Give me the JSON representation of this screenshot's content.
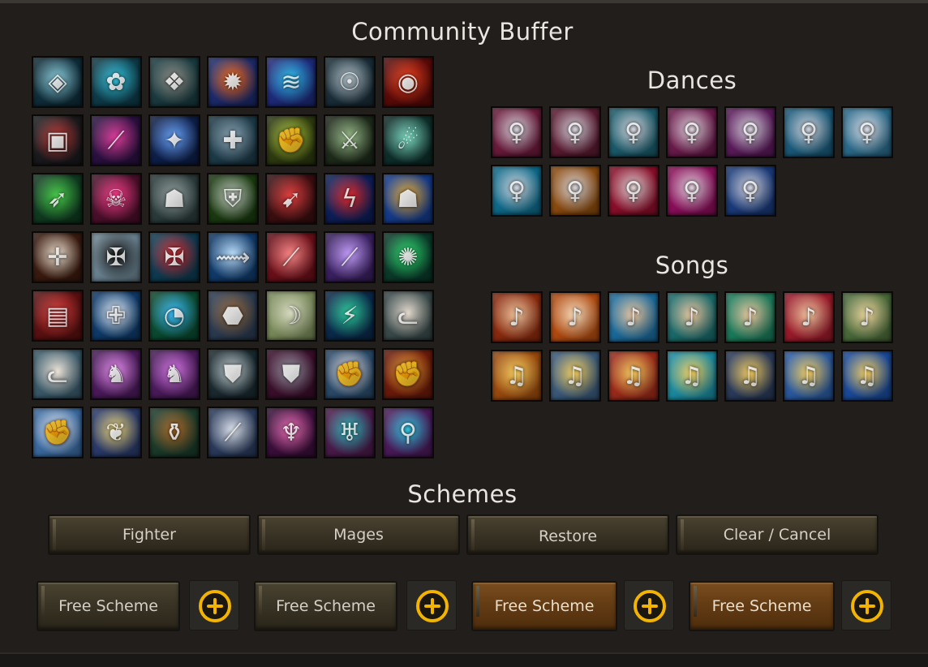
{
  "window": {
    "title": "Community Buffer"
  },
  "sections": {
    "dances": "Dances",
    "songs": "Songs",
    "schemes": "Schemes"
  },
  "buff_icons": [
    {
      "name": "shield-rune-icon",
      "c1": "#0f2d3a",
      "c2": "#8ed1e0",
      "g": "◈"
    },
    {
      "name": "cyan-wheel-icon",
      "c1": "#0e3a48",
      "c2": "#34c6e0",
      "g": "✿"
    },
    {
      "name": "stone-wheel-icon",
      "c1": "#1a3a3f",
      "c2": "#8e8e86",
      "g": "❖"
    },
    {
      "name": "flame-swirl-icon",
      "c1": "#1c2a6b",
      "c2": "#ff6a12",
      "g": "✹"
    },
    {
      "name": "water-swirl-icon",
      "c1": "#1e2a7a",
      "c2": "#2fc4f0",
      "g": "≋"
    },
    {
      "name": "mystic-face-icon",
      "c1": "#1a2d38",
      "c2": "#b8c8d0",
      "g": "☉"
    },
    {
      "name": "fire-eye-icon",
      "c1": "#5a0a08",
      "c2": "#f0421e",
      "g": "◉"
    },
    {
      "name": "red-rune-icon",
      "c1": "#1a1a1e",
      "c2": "#c23a36",
      "g": "▣"
    },
    {
      "name": "pink-slash-icon",
      "c1": "#2a1040",
      "c2": "#e23e9c",
      "g": "⟋"
    },
    {
      "name": "blue-orb-hand-icon",
      "c1": "#0d1e48",
      "c2": "#6aa6ff",
      "g": "✦"
    },
    {
      "name": "mace-icon",
      "c1": "#1d3a48",
      "c2": "#8fa8b8",
      "g": "✚"
    },
    {
      "name": "fist-strike-icon",
      "c1": "#2e3a10",
      "c2": "#b6d33a",
      "g": "✊"
    },
    {
      "name": "green-blade-icon",
      "c1": "#1e2a1a",
      "c2": "#9dc28e",
      "g": "⚔"
    },
    {
      "name": "wind-spiral-icon",
      "c1": "#0e2e2a",
      "c2": "#7fe0c8",
      "g": "☄"
    },
    {
      "name": "green-spear-icon",
      "c1": "#0f3a20",
      "c2": "#48d04a",
      "g": "➶"
    },
    {
      "name": "skull-flame-icon",
      "c1": "#4a0f2a",
      "c2": "#ff3e8e",
      "g": "☠"
    },
    {
      "name": "stone-golem-icon",
      "c1": "#2a3a3a",
      "c2": "#9aa6a6",
      "g": "☗"
    },
    {
      "name": "knight-helm-icon",
      "c1": "#1a3a10",
      "c2": "#c8d0c8",
      "g": "⛨"
    },
    {
      "name": "red-arrow-icon",
      "c1": "#3a0e10",
      "c2": "#e84040",
      "g": "➹"
    },
    {
      "name": "red-lightning-icon",
      "c1": "#0c1e58",
      "c2": "#e42a2a",
      "g": "ϟ"
    },
    {
      "name": "blue-golem-icon",
      "c1": "#143a8a",
      "c2": "#f0b030",
      "g": "☗"
    },
    {
      "name": "fire-cross-icon",
      "c1": "#3a1a0e",
      "c2": "#f2e6d6",
      "g": "✛"
    },
    {
      "name": "dark-cross-icon",
      "c1": "#6a8290",
      "c2": "#1a1a1a",
      "g": "✠"
    },
    {
      "name": "red-cross-icon",
      "c1": "#0e3a50",
      "c2": "#e02a30",
      "g": "✠"
    },
    {
      "name": "blue-wing-icon",
      "c1": "#103a6a",
      "c2": "#bfe2ff",
      "g": "⟿"
    },
    {
      "name": "red-spear-icon",
      "c1": "#6a0f18",
      "c2": "#ff8a8a",
      "g": "⟋"
    },
    {
      "name": "purple-blade-icon",
      "c1": "#3a2060",
      "c2": "#c6a0ff",
      "g": "⟋"
    },
    {
      "name": "green-thorn-icon",
      "c1": "#0a3a2a",
      "c2": "#2ee070",
      "g": "✺"
    },
    {
      "name": "red-rune-block-icon",
      "c1": "#5a1010",
      "c2": "#e04040",
      "g": "▤"
    },
    {
      "name": "blue-cross-disc-icon",
      "c1": "#0e3a6a",
      "c2": "#eaf4ff",
      "g": "✙"
    },
    {
      "name": "green-wave-icon",
      "c1": "#0a4a30",
      "c2": "#3ec0ff",
      "g": "◔"
    },
    {
      "name": "rock-shell-icon",
      "c1": "#2a3a50",
      "c2": "#9a6a3a",
      "g": "⬣"
    },
    {
      "name": "spirit-ghost-icon",
      "c1": "#7a8a5a",
      "c2": "#d8dcc2",
      "g": "☽"
    },
    {
      "name": "green-vine-icon",
      "c1": "#0a2a4a",
      "c2": "#2ed0a0",
      "g": "⚡"
    },
    {
      "name": "cat-face-icon",
      "c1": "#3a4a4a",
      "c2": "#e6dcd0",
      "g": "ᓚ"
    },
    {
      "name": "white-cat-icon",
      "c1": "#3a5a6a",
      "c2": "#f0e6da",
      "g": "ᓚ"
    },
    {
      "name": "pink-unicorn-icon",
      "c1": "#4a1a5a",
      "c2": "#e890f0",
      "g": "♞"
    },
    {
      "name": "pink-horse-icon",
      "c1": "#4a1a5a",
      "c2": "#d878e8",
      "g": "♞"
    },
    {
      "name": "silver-shield-icon",
      "c1": "#1a2a30",
      "c2": "#c8d4d8",
      "g": "⛊"
    },
    {
      "name": "crimson-shield-icon",
      "c1": "#3a0e2a",
      "c2": "#9a9aa8",
      "g": "⛊"
    },
    {
      "name": "fist-ice-icon",
      "c1": "#2a4a6a",
      "c2": "#f0e6e6",
      "g": "✊"
    },
    {
      "name": "fist-fire-icon",
      "c1": "#6a1a0a",
      "c2": "#f0a030",
      "g": "✊"
    },
    {
      "name": "fist-sky-icon",
      "c1": "#3a6aa0",
      "c2": "#f0f0f8",
      "g": "✊"
    },
    {
      "name": "golden-wing-icon",
      "c1": "#2a3a6a",
      "c2": "#f0d878",
      "g": "❦"
    },
    {
      "name": "clay-pot-icon",
      "c1": "#1a3a2a",
      "c2": "#b06a2a",
      "g": "⚱"
    },
    {
      "name": "silver-spear-icon",
      "c1": "#2a3a5a",
      "c2": "#e0e6f0",
      "g": "⟋"
    },
    {
      "name": "pink-angel-icon",
      "c1": "#3a0e3a",
      "c2": "#f070b8",
      "g": "♆"
    },
    {
      "name": "teal-eagle-icon",
      "c1": "#4a1a4a",
      "c2": "#2ec0c0",
      "g": "♅"
    },
    {
      "name": "cyan-staff-icon",
      "c1": "#4a1a5a",
      "c2": "#30c8e0",
      "g": "⚲"
    }
  ],
  "dance_icons": [
    {
      "name": "dance-1-icon",
      "c1": "#6a1a3a",
      "c2": "#d8d8e0",
      "g": "♀"
    },
    {
      "name": "dance-2-icon",
      "c1": "#5a1a30",
      "c2": "#d8d8e0",
      "g": "♀"
    },
    {
      "name": "dance-3-icon",
      "c1": "#1a5a6a",
      "c2": "#d8d8e0",
      "g": "♀"
    },
    {
      "name": "dance-4-icon",
      "c1": "#6a1a4a",
      "c2": "#e0d8e0",
      "g": "♀"
    },
    {
      "name": "dance-5-icon",
      "c1": "#5a1a5a",
      "c2": "#d8d8e0",
      "g": "♀"
    },
    {
      "name": "dance-6-icon",
      "c1": "#1a5a7a",
      "c2": "#d8d8e0",
      "g": "♀"
    },
    {
      "name": "dance-7-icon",
      "c1": "#2a6a8a",
      "c2": "#e0e0e8",
      "g": "♀"
    },
    {
      "name": "dance-8-icon",
      "c1": "#0e6a8a",
      "c2": "#d8d8e0",
      "g": "♀"
    },
    {
      "name": "dance-9-icon",
      "c1": "#8a4a0e",
      "c2": "#d8d8e0",
      "g": "♀"
    },
    {
      "name": "dance-10-icon",
      "c1": "#8a0e2a",
      "c2": "#e0d8d8",
      "g": "♀"
    },
    {
      "name": "dance-11-icon",
      "c1": "#8a0e5a",
      "c2": "#e0d8e0",
      "g": "♀"
    },
    {
      "name": "dance-12-icon",
      "c1": "#1a3a7a",
      "c2": "#d8d8e0",
      "g": "♀"
    }
  ],
  "song_icons": [
    {
      "name": "song-1-icon",
      "c1": "#8a2a0e",
      "c2": "#f0c8a0",
      "g": "♪"
    },
    {
      "name": "song-2-icon",
      "c1": "#b04a10",
      "c2": "#f8e0c0",
      "g": "♪"
    },
    {
      "name": "song-3-icon",
      "c1": "#1a6a9a",
      "c2": "#f0c8a0",
      "g": "♪"
    },
    {
      "name": "song-4-icon",
      "c1": "#1a6a6a",
      "c2": "#f0c8a0",
      "g": "♪"
    },
    {
      "name": "song-5-icon",
      "c1": "#1a7a5a",
      "c2": "#f0c8a0",
      "g": "♪"
    },
    {
      "name": "song-6-icon",
      "c1": "#9a1a2a",
      "c2": "#f0c8a0",
      "g": "♪"
    },
    {
      "name": "song-7-icon",
      "c1": "#4a6a3a",
      "c2": "#f0d8a0",
      "g": "♪"
    },
    {
      "name": "song-8-icon",
      "c1": "#9a4a0e",
      "c2": "#f8d060",
      "g": "♫"
    },
    {
      "name": "song-9-icon",
      "c1": "#3a5a7a",
      "c2": "#f8d060",
      "g": "♫"
    },
    {
      "name": "song-10-icon",
      "c1": "#9a2a1a",
      "c2": "#f8d060",
      "g": "♫"
    },
    {
      "name": "song-11-icon",
      "c1": "#1a8aa0",
      "c2": "#f8d060",
      "g": "♫"
    },
    {
      "name": "song-12-icon",
      "c1": "#2a3a5a",
      "c2": "#f8d060",
      "g": "♫"
    },
    {
      "name": "song-13-icon",
      "c1": "#2a5aa0",
      "c2": "#f8d060",
      "g": "♫"
    },
    {
      "name": "song-14-icon",
      "c1": "#1a4a9a",
      "c2": "#f8d060",
      "g": "♫"
    }
  ],
  "scheme_buttons": {
    "fighter": "Fighter",
    "mages": "Mages",
    "restore": "Restore",
    "clear": "Clear / Cancel"
  },
  "free_schemes": [
    {
      "label": "Free Scheme"
    },
    {
      "label": "Free Scheme"
    },
    {
      "label": "Free Scheme"
    },
    {
      "label": "Free Scheme"
    }
  ],
  "colors": {
    "accent": "#f2b400",
    "active_scheme": "#643c14"
  }
}
